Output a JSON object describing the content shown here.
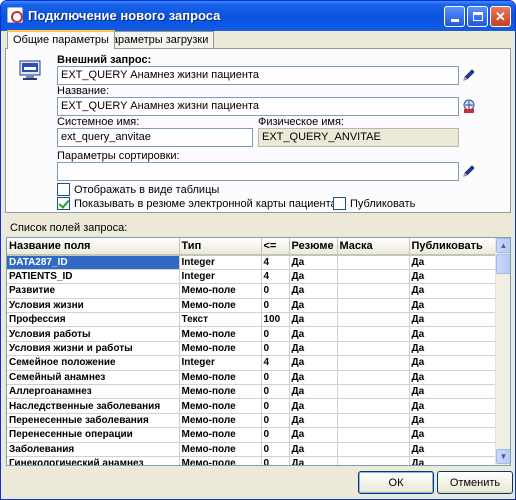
{
  "window": {
    "title": "Подключение нового запроса"
  },
  "tabs": [
    {
      "label": "Общие параметры",
      "active": true
    },
    {
      "label": "Параметры загрузки",
      "active": false
    }
  ],
  "form": {
    "external_query_label": "Внешний запрос:",
    "external_query_value": "EXT_QUERY Анамнез жизни пациента",
    "name_label": "Название:",
    "name_value": "EXT_QUERY Анамнез жизни пациента",
    "system_name_label": "Системное имя:",
    "system_name_value": "ext_query_anvitae",
    "physical_name_label": "Физическое имя:",
    "physical_name_value": "EXT_QUERY_ANVITAE",
    "sort_params_label": "Параметры сортировки:",
    "sort_params_value": "",
    "show_as_table_label": "Отображать в виде таблицы",
    "show_as_table_checked": false,
    "show_in_summary_label": "Показывать в резюме электронной карты пациента",
    "show_in_summary_checked": true,
    "publish_label": "Публиковать",
    "publish_checked": false
  },
  "fields_list": {
    "caption": "Список полей запроса:",
    "columns": [
      "Название поля",
      "Тип",
      "<=",
      "Резюме",
      "Маска",
      "Публиковать"
    ],
    "rows": [
      [
        "DATA287_ID",
        "Integer",
        "4",
        "Да",
        "",
        "Да"
      ],
      [
        "PATIENTS_ID",
        "Integer",
        "4",
        "Да",
        "",
        "Да"
      ],
      [
        "Развитие",
        "Мемо-поле",
        "0",
        "Да",
        "",
        "Да"
      ],
      [
        "Условия жизни",
        "Мемо-поле",
        "0",
        "Да",
        "",
        "Да"
      ],
      [
        "Профессия",
        "Текст",
        "100",
        "Да",
        "",
        "Да"
      ],
      [
        "Условия работы",
        "Мемо-поле",
        "0",
        "Да",
        "",
        "Да"
      ],
      [
        "Условия жизни и работы",
        "Мемо-поле",
        "0",
        "Да",
        "",
        "Да"
      ],
      [
        "Семейное положение",
        "Integer",
        "4",
        "Да",
        "",
        "Да"
      ],
      [
        "Семейный анамнез",
        "Мемо-поле",
        "0",
        "Да",
        "",
        "Да"
      ],
      [
        "Аллергоанамнез",
        "Мемо-поле",
        "0",
        "Да",
        "",
        "Да"
      ],
      [
        "Наследственные заболевания",
        "Мемо-поле",
        "0",
        "Да",
        "",
        "Да"
      ],
      [
        "Перенесенные заболевания",
        "Мемо-поле",
        "0",
        "Да",
        "",
        "Да"
      ],
      [
        "Перенесенные операции",
        "Мемо-поле",
        "0",
        "Да",
        "",
        "Да"
      ],
      [
        "Заболевания",
        "Мемо-поле",
        "0",
        "Да",
        "",
        "Да"
      ],
      [
        "Гинекологический анамнез",
        "Мемо-поле",
        "0",
        "Да",
        "",
        "Да"
      ]
    ],
    "selected_row": 0
  },
  "buttons": {
    "ok": "ОК",
    "cancel": "Отменить"
  }
}
